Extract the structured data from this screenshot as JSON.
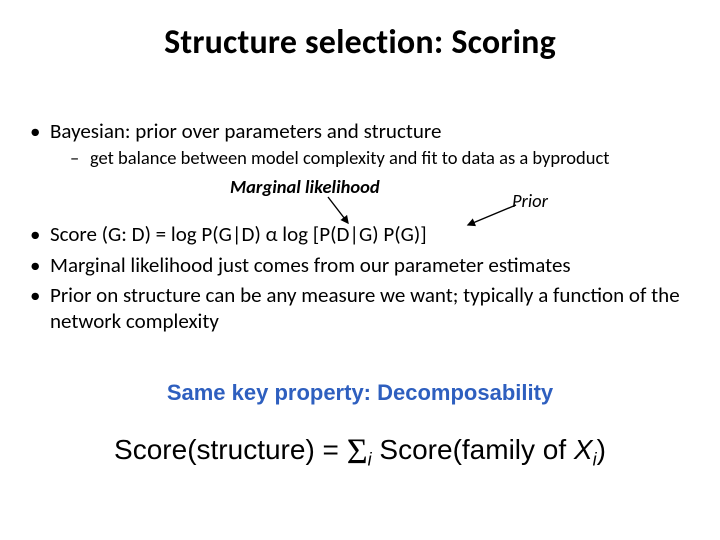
{
  "title": "Structure selection: Scoring",
  "bullets": {
    "b1": "Bayesian: prior over parameters and structure",
    "b1a": "get balance between model complexity and fit to data as a byproduct",
    "ml_label": "Marginal likelihood",
    "prior_label": "Prior",
    "b2_pre": "Score (G: D) = log P(G|D) ",
    "b2_prop": "α",
    "b2_post": " log [P(D|G) P(G)]",
    "b3": "Marginal likelihood just comes from our parameter estimates",
    "b4": "Prior on structure can be any measure we want; typically a function of the network complexity"
  },
  "key_property": "Same key property: Decomposability",
  "formula": {
    "lhs": "Score(structure) = ",
    "sum": "Σ",
    "sub": "i",
    "rhs_pre": " Score(family of ",
    "xvar": "X",
    "xsub": "i",
    "rhs_post": ")"
  }
}
